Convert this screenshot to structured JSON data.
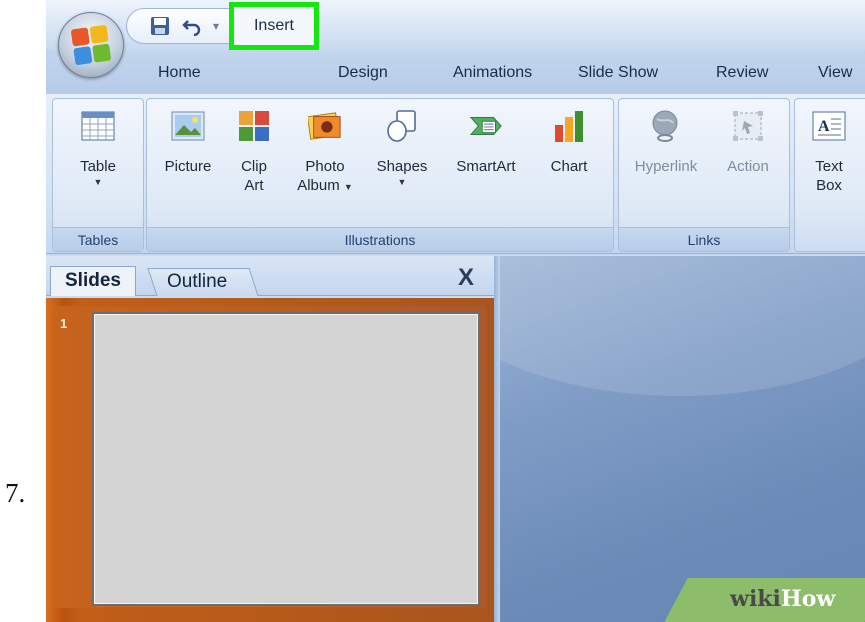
{
  "step_number": "7.",
  "quick_access": {
    "icons": [
      "save-icon",
      "undo-icon",
      "redo-icon",
      "customize-icon"
    ],
    "undo_caret": "▾"
  },
  "tabs": [
    "Home",
    "Insert",
    "Design",
    "Animations",
    "Slide Show",
    "Review",
    "View"
  ],
  "active_tab": "Insert",
  "highlight_color": "#12e80c",
  "ribbon": {
    "groups": [
      {
        "label": "Tables",
        "commands": [
          {
            "label1": "Table",
            "label2": "",
            "icon": "table-icon"
          }
        ]
      },
      {
        "label": "Illustrations",
        "commands": [
          {
            "label1": "Picture",
            "label2": "",
            "icon": "picture-icon"
          },
          {
            "label1": "Clip",
            "label2": "Art",
            "icon": "clip-art-icon"
          },
          {
            "label1": "Photo",
            "label2": "Album",
            "icon": "photo-album-icon"
          },
          {
            "label1": "Shapes",
            "label2": "",
            "icon": "shapes-icon"
          },
          {
            "label1": "SmartArt",
            "label2": "",
            "icon": "smartart-icon"
          },
          {
            "label1": "Chart",
            "label2": "",
            "icon": "chart-icon"
          }
        ]
      },
      {
        "label": "Links",
        "commands": [
          {
            "label1": "Hyperlink",
            "label2": "",
            "icon": "hyperlink-icon"
          },
          {
            "label1": "Action",
            "label2": "",
            "icon": "action-icon"
          }
        ]
      },
      {
        "label": "",
        "commands": [
          {
            "label1": "Text",
            "label2": "Box",
            "icon": "text-box-icon"
          }
        ]
      }
    ]
  },
  "slides_pane": {
    "tab_slides": "Slides",
    "tab_outline": "Outline",
    "close": "X",
    "slide_number": "1"
  },
  "watermark": {
    "part1": "wiki",
    "part2": "How"
  }
}
